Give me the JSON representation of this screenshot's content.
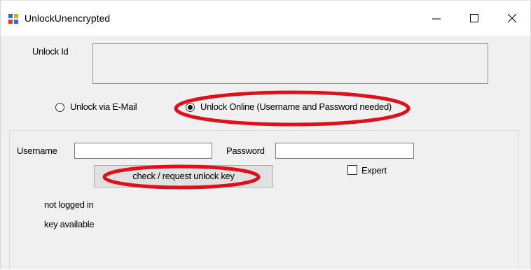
{
  "window": {
    "title": "UnlockUnencrypted",
    "app_icon": "windows-form-icon",
    "controls": [
      "minimize-icon",
      "maximize-icon",
      "close-icon"
    ]
  },
  "unlock_id": {
    "label": "Unlock Id",
    "value": ""
  },
  "unlock_method": {
    "options": [
      {
        "label": "Unlock via E-Mail",
        "selected": false
      },
      {
        "label": "Unlock Online (Username and Password needed)",
        "selected": true
      }
    ]
  },
  "credentials": {
    "username_label": "Username",
    "username_value": "",
    "password_label": "Password",
    "password_value": ""
  },
  "actions": {
    "check_button_label": "check / request unlock key"
  },
  "expert": {
    "label": "Expert",
    "checked": false
  },
  "status": {
    "login": "not logged in",
    "key": "key available"
  },
  "colors": {
    "annotation_red": "#e0101a",
    "window_bg": "#f0f0f0"
  }
}
